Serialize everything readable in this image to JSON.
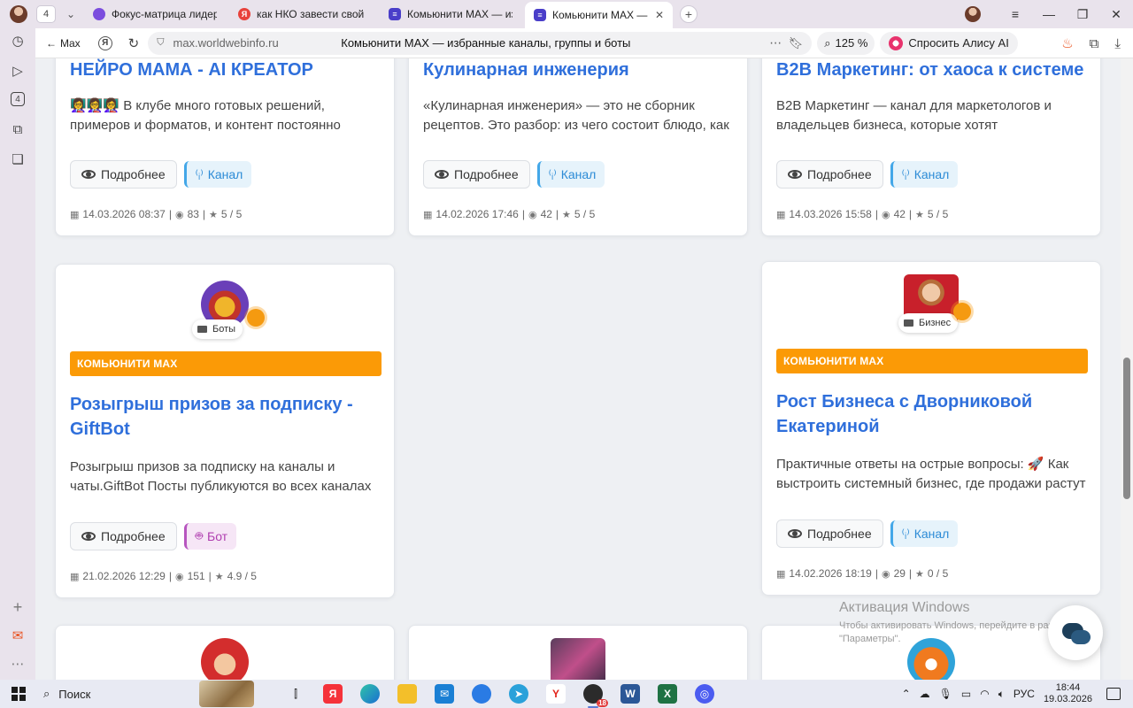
{
  "browser": {
    "tab_count": "4",
    "tabs": [
      {
        "title": "Фокус-матрица лидера: к",
        "favicon_color": "#7b4dde"
      },
      {
        "title": "как НКО завести свой пуб",
        "favicon_color": "#e8423b"
      },
      {
        "title": "Комьюнити МАХ — избра",
        "favicon_color": "#4a3ec9"
      },
      {
        "title": "Комьюнити МАХ — изб",
        "favicon_color": "#4a3ec9"
      }
    ],
    "back_label": "Max",
    "url_host": "max.worldwebinfo.ru",
    "page_title": "Комьюнити MAX — избранные каналы, группы и боты",
    "zoom": "125 %",
    "alice_label": "Спросить Алису AI"
  },
  "sidebar_icons": [
    "history-icon",
    "play-icon",
    "badge-4-icon",
    "screenshot-icon",
    "collections-icon",
    "add-icon",
    "mail-icon",
    "more-icon"
  ],
  "common": {
    "more_label": "Подробнее",
    "band_label": "КОМЬЮНИТИ MAX",
    "channel_label": "Канал",
    "bot_label": "Бот"
  },
  "cards": [
    {
      "title": "НЕЙРО МАМА - AI КРЕАТОР",
      "desc": "👩‍🏫👩‍🏫👩‍🏫 В клубе много готовых решений, примеров и форматов, и контент постоянно",
      "type": "Канал",
      "date": "14.03.2026 08:37",
      "views": "83",
      "rating": "5 / 5"
    },
    {
      "title": "Кулинарная инженерия",
      "desc": "«Кулинарная инженерия» — это не сборник рецептов. Это разбор: из чего состоит блюдо, как",
      "type": "Канал",
      "date": "14.02.2026 17:46",
      "views": "42",
      "rating": "5 / 5"
    },
    {
      "title": "B2B Маркетинг: от хаоса к системе",
      "desc": "B2B Маркетинг — канал для маркетологов и владельцев бизнеса, которые хотят",
      "type": "Канал",
      "date": "14.03.2026 15:58",
      "views": "42",
      "rating": "5 / 5"
    },
    {
      "category": "Боты",
      "title": "Розыгрыш призов за подписку - GiftBot",
      "desc": "Розыгрыш призов за подписку на каналы и чаты.GiftBot Посты публикуются во всех каналах",
      "type": "Бот",
      "date": "21.02.2026 12:29",
      "views": "151",
      "rating": "4.9 / 5"
    },
    {
      "category": "Бизнес",
      "title": "Рост Бизнеса с Дворниковой Екатериной",
      "desc": "Практичные ответы на острые вопросы: 🚀 Как выстроить системный бизнес, где продажи растут",
      "type": "Канал",
      "date": "14.02.2026 18:19",
      "views": "29",
      "rating": "0 / 5"
    }
  ],
  "activation": {
    "title": "Активация Windows",
    "text": "Чтобы активировать Windows, перейдите в раздел \"Параметры\"."
  },
  "taskbar": {
    "search_label": "Поиск",
    "lang": "РУС",
    "time": "18:44",
    "date": "19.03.2026",
    "telegram_badge": "18"
  }
}
